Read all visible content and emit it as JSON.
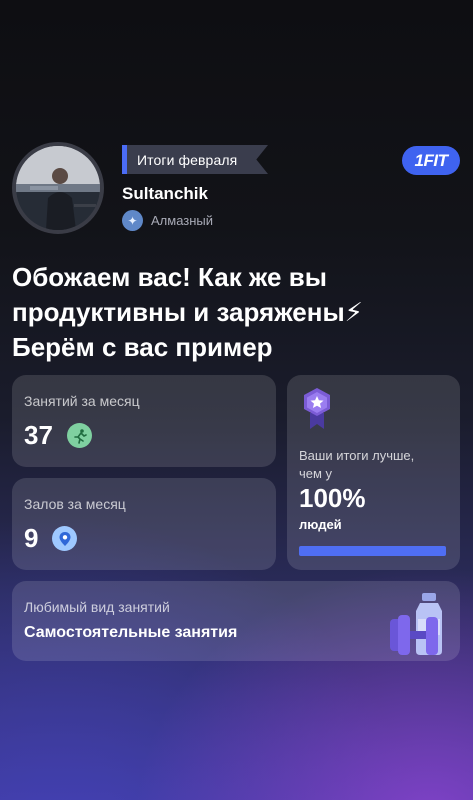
{
  "header": {
    "ribbon_label": "Итоги февраля",
    "username": "Sultanchik",
    "tier_label": "Алмазный",
    "logo_text": "1FIT"
  },
  "headline": {
    "line1": "Обожаем вас! Как же вы",
    "line2": "продуктивны и заряжены⚡",
    "line3": "Берём с вас пример"
  },
  "stats": {
    "sessions": {
      "label": "Занятий за месяц",
      "value": "37",
      "icon": "running-icon"
    },
    "gyms": {
      "label": "Залов за месяц",
      "value": "9",
      "icon": "location-pin-icon"
    }
  },
  "comparison": {
    "text_line1": "Ваши итоги лучше,",
    "text_line2": "чем у",
    "percent": "100%",
    "people": "людей",
    "progress_fraction": 1.0,
    "icon": "medal-star-icon"
  },
  "favorite": {
    "label": "Любимый вид занятий",
    "value": "Самостоятельные занятия",
    "icon": "dumbbell-bottle-icon"
  },
  "colors": {
    "accent": "#4b6cf5",
    "running_icon_bg": "#7fd0a0",
    "pin_icon_bg": "#9ec8ff",
    "medal": "#7b5cd6"
  }
}
